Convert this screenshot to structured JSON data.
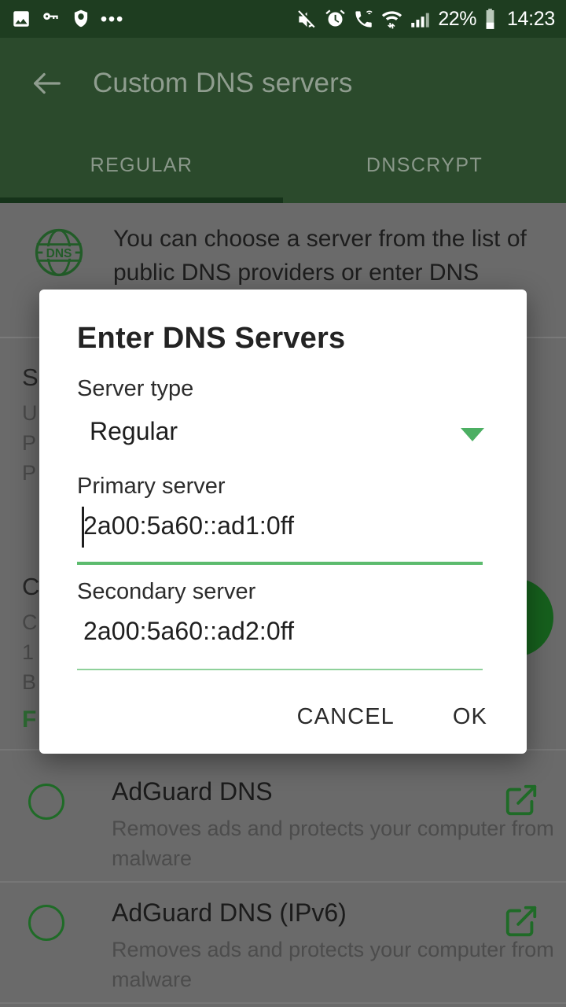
{
  "status_bar": {
    "left_icons": [
      "image-icon",
      "key-icon",
      "bug-shield-icon",
      "more-dots-icon"
    ],
    "right_icons": [
      "mute-icon",
      "alarm-icon",
      "wifi-calling-icon",
      "wifi-transfer-icon",
      "signal-bars-icon",
      "battery-icon"
    ],
    "battery_percent": "22%",
    "clock": "14:23"
  },
  "app_bar": {
    "back_icon": "back-arrow-icon",
    "title": "Custom DNS servers"
  },
  "tabs": {
    "items": [
      {
        "label": "REGULAR",
        "selected": true
      },
      {
        "label": "DNSCRYPT",
        "selected": false
      }
    ]
  },
  "info": {
    "icon": "dns-globe-icon",
    "icon_label": "DNS",
    "text": "You can choose a server from the list of public DNS providers or enter DNS"
  },
  "background": {
    "section_1_title": "S",
    "section_1_sub": "U\nP\nP",
    "section_2_title": "C",
    "section_2_sub": "C\n1\nB",
    "fab_label": "F",
    "add_fab": "add-server-fab"
  },
  "dialog": {
    "title": "Enter DNS Servers",
    "server_type_label": "Server type",
    "server_type_value": "Regular",
    "server_type_options": [
      "Regular"
    ],
    "dropdown_icon": "chevron-down-icon",
    "primary_label": "Primary server",
    "primary_value": "2a00:5a60::ad1:0ff",
    "secondary_label": "Secondary server",
    "secondary_value": "2a00:5a60::ad2:0ff",
    "cancel_label": "CANCEL",
    "ok_label": "OK"
  },
  "server_list": [
    {
      "title": "AdGuard DNS",
      "subtitle": "Removes ads and protects your computer from malware",
      "selected": false,
      "link_icon": "external-link-icon"
    },
    {
      "title": "AdGuard DNS (IPv6)",
      "subtitle": "Removes ads and protects your computer from malware",
      "selected": false,
      "link_icon": "external-link-icon"
    }
  ],
  "colors": {
    "status_bar": "#1e3d20",
    "app_bar": "#2b4a2c",
    "tab_indicator": "#16331a",
    "accent_green": "#5cbb6e",
    "dark_green": "#1f6b27",
    "scrim_gray": "#6a6a6a"
  }
}
